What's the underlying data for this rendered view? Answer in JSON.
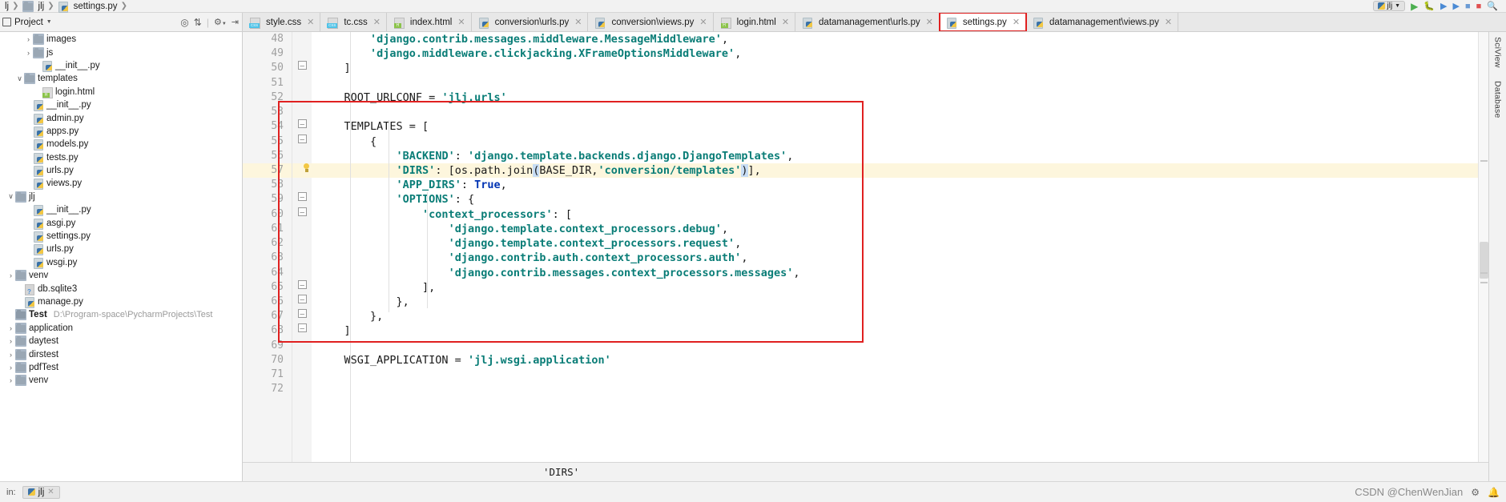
{
  "window": {
    "breadcrumb": [
      "lj",
      "jlj",
      "settings.py"
    ],
    "project_selector": "jlj"
  },
  "toolbar": {
    "project_label": "Project",
    "icons": [
      "target-icon",
      "collapse-all-icon",
      "settings-gear-icon",
      "hide-panel-icon"
    ],
    "run_icons": [
      "run-icon",
      "debug-icon",
      "coverage-icon",
      "profile-icon",
      "build-icon",
      "stop-icon",
      "search-icon"
    ]
  },
  "tabs": [
    {
      "label": "style.css",
      "icon": "css-file-icon",
      "active": false,
      "highlight": false
    },
    {
      "label": "tc.css",
      "icon": "css-file-icon",
      "active": false,
      "highlight": false
    },
    {
      "label": "index.html",
      "icon": "html-file-icon",
      "active": false,
      "highlight": false
    },
    {
      "label": "conversion\\urls.py",
      "icon": "python-file-icon",
      "active": false,
      "highlight": false
    },
    {
      "label": "conversion\\views.py",
      "icon": "python-file-icon",
      "active": false,
      "highlight": false
    },
    {
      "label": "login.html",
      "icon": "html-file-icon",
      "active": false,
      "highlight": false
    },
    {
      "label": "datamanagement\\urls.py",
      "icon": "python-file-icon",
      "active": false,
      "highlight": false
    },
    {
      "label": "settings.py",
      "icon": "python-file-icon",
      "active": true,
      "highlight": true
    },
    {
      "label": "datamanagement\\views.py",
      "icon": "python-file-icon",
      "active": false,
      "highlight": false
    }
  ],
  "sidebar": {
    "items": [
      {
        "label": "images",
        "icon": "folder-icon",
        "indent": 2,
        "arrow": "›",
        "bold": false
      },
      {
        "label": "js",
        "icon": "folder-icon",
        "indent": 2,
        "arrow": "›",
        "bold": false
      },
      {
        "label": "__init__.py",
        "icon": "python-file-icon",
        "indent": 3,
        "arrow": "",
        "bold": false
      },
      {
        "label": "templates",
        "icon": "folder-icon",
        "indent": 1,
        "arrow": "∨",
        "bold": false
      },
      {
        "label": "login.html",
        "icon": "html-file-icon",
        "indent": 3,
        "arrow": "",
        "bold": false
      },
      {
        "label": "__init__.py",
        "icon": "python-file-icon",
        "indent": 2,
        "arrow": "",
        "bold": false
      },
      {
        "label": "admin.py",
        "icon": "python-file-icon",
        "indent": 2,
        "arrow": "",
        "bold": false
      },
      {
        "label": "apps.py",
        "icon": "python-file-icon",
        "indent": 2,
        "arrow": "",
        "bold": false
      },
      {
        "label": "models.py",
        "icon": "python-file-icon",
        "indent": 2,
        "arrow": "",
        "bold": false
      },
      {
        "label": "tests.py",
        "icon": "python-file-icon",
        "indent": 2,
        "arrow": "",
        "bold": false
      },
      {
        "label": "urls.py",
        "icon": "python-file-icon",
        "indent": 2,
        "arrow": "",
        "bold": false
      },
      {
        "label": "views.py",
        "icon": "python-file-icon",
        "indent": 2,
        "arrow": "",
        "bold": false
      },
      {
        "label": "jlj",
        "icon": "folder-icon",
        "indent": 0,
        "arrow": "∨",
        "bold": false
      },
      {
        "label": "__init__.py",
        "icon": "python-file-icon",
        "indent": 2,
        "arrow": "",
        "bold": false
      },
      {
        "label": "asgi.py",
        "icon": "python-file-icon",
        "indent": 2,
        "arrow": "",
        "bold": false
      },
      {
        "label": "settings.py",
        "icon": "python-file-icon",
        "indent": 2,
        "arrow": "",
        "bold": false
      },
      {
        "label": "urls.py",
        "icon": "python-file-icon",
        "indent": 2,
        "arrow": "",
        "bold": false
      },
      {
        "label": "wsgi.py",
        "icon": "python-file-icon",
        "indent": 2,
        "arrow": "",
        "bold": false
      },
      {
        "label": "venv",
        "icon": "folder-icon",
        "indent": 0,
        "arrow": "›",
        "bold": false
      },
      {
        "label": "db.sqlite3",
        "icon": "database-file-icon",
        "indent": 1,
        "arrow": "",
        "bold": false
      },
      {
        "label": "manage.py",
        "icon": "python-file-icon",
        "indent": 1,
        "arrow": "",
        "bold": false
      },
      {
        "label": "Test",
        "icon": "folder-icon",
        "indent": 0,
        "arrow": "",
        "bold": true,
        "path": "D:\\Program-space\\PycharmProjects\\Test"
      },
      {
        "label": "application",
        "icon": "folder-icon",
        "indent": 0,
        "arrow": "›",
        "bold": false
      },
      {
        "label": "daytest",
        "icon": "folder-icon",
        "indent": 0,
        "arrow": "›",
        "bold": false
      },
      {
        "label": "dirstest",
        "icon": "folder-icon",
        "indent": 0,
        "arrow": "›",
        "bold": false
      },
      {
        "label": "pdfTest",
        "icon": "folder-icon",
        "indent": 0,
        "arrow": "›",
        "bold": false
      },
      {
        "label": "venv",
        "icon": "folder-icon",
        "indent": 0,
        "arrow": "›",
        "bold": false
      }
    ]
  },
  "editor": {
    "first_line_number": 48,
    "highlighted_line": 57,
    "lines": [
      {
        "n": 48,
        "fold": "",
        "html": "        <span class='tok-str'>'django.contrib.messages.middleware.MessageMiddleware'</span><span class='tok-plain'>,</span>"
      },
      {
        "n": 49,
        "fold": "",
        "html": "        <span class='tok-str'>'django.middleware.clickjacking.XFrameOptionsMiddleware'</span><span class='tok-plain'>,</span>"
      },
      {
        "n": 50,
        "fold": "−",
        "html": "    <span class='tok-plain'>]</span>"
      },
      {
        "n": 51,
        "fold": "",
        "html": ""
      },
      {
        "n": 52,
        "fold": "",
        "html": "    <span class='tok-plain'>ROOT_URLCONF = </span><span class='tok-str'>'jlj.urls'</span>"
      },
      {
        "n": 53,
        "fold": "",
        "html": ""
      },
      {
        "n": 54,
        "fold": "−",
        "html": "    <span class='tok-plain'>TEMPLATES = [</span>"
      },
      {
        "n": 55,
        "fold": "−",
        "html": "        <span class='tok-plain'>{</span>"
      },
      {
        "n": 56,
        "fold": "",
        "html": "            <span class='tok-str'>'BACKEND'</span><span class='tok-plain'>: </span><span class='tok-str'>'django.template.backends.django.DjangoTemplates'</span><span class='tok-plain'>,</span>"
      },
      {
        "n": 57,
        "fold": "",
        "html": "            <span class='tok-str'>'DIRS'</span><span class='tok-plain'>: [os.path.join</span><span class='caret-hl tok-plain'>(</span><span class='tok-plain'>BASE_DIR,</span><span class='tok-str'>'conversion/templates'</span><span class='caret-hl tok-plain'>)</span><span class='tok-plain'>],</span>"
      },
      {
        "n": 58,
        "fold": "",
        "html": "            <span class='tok-str'>'APP_DIRS'</span><span class='tok-plain'>: </span><span class='tok-kw'>True</span><span class='tok-plain'>,</span>"
      },
      {
        "n": 59,
        "fold": "−",
        "html": "            <span class='tok-str'>'OPTIONS'</span><span class='tok-plain'>: {</span>"
      },
      {
        "n": 60,
        "fold": "−",
        "html": "                <span class='tok-str'>'context_processors'</span><span class='tok-plain'>: [</span>"
      },
      {
        "n": 61,
        "fold": "",
        "html": "                    <span class='tok-str'>'django.template.context_processors.debug'</span><span class='tok-plain'>,</span>"
      },
      {
        "n": 62,
        "fold": "",
        "html": "                    <span class='tok-str'>'django.template.context_processors.request'</span><span class='tok-plain'>,</span>"
      },
      {
        "n": 63,
        "fold": "",
        "html": "                    <span class='tok-str'>'django.contrib.auth.context_processors.auth'</span><span class='tok-plain'>,</span>"
      },
      {
        "n": 64,
        "fold": "",
        "html": "                    <span class='tok-str'>'django.contrib.messages.context_processors.messages'</span><span class='tok-plain'>,</span>"
      },
      {
        "n": 65,
        "fold": "−",
        "html": "                <span class='tok-plain'>],</span>"
      },
      {
        "n": 66,
        "fold": "−",
        "html": "            <span class='tok-plain'>},</span>"
      },
      {
        "n": 67,
        "fold": "−",
        "html": "        <span class='tok-plain'>},</span>"
      },
      {
        "n": 68,
        "fold": "−",
        "html": "    <span class='tok-plain'>]</span>"
      },
      {
        "n": 69,
        "fold": "",
        "html": ""
      },
      {
        "n": 70,
        "fold": "",
        "html": "    <span class='tok-plain'>WSGI_APPLICATION = </span><span class='tok-str'>'jlj.wsgi.application'</span>"
      },
      {
        "n": 71,
        "fold": "",
        "html": ""
      },
      {
        "n": 72,
        "fold": "",
        "html": ""
      }
    ]
  },
  "bottom": {
    "breadcrumb_value": "'DIRS'",
    "run_tab_label": "jlj",
    "run_prefix": "in:",
    "watermark": "CSDN @ChenWenJian"
  },
  "right_rail": {
    "labels": [
      "SciView",
      "Database"
    ]
  },
  "colors": {
    "annotation_red": "#e02020",
    "string_teal": "#0a7d77",
    "keyword_blue": "#0033b3",
    "highlight_yellow": "#fdf6dd",
    "caret_blue": "#c7ddf5"
  }
}
